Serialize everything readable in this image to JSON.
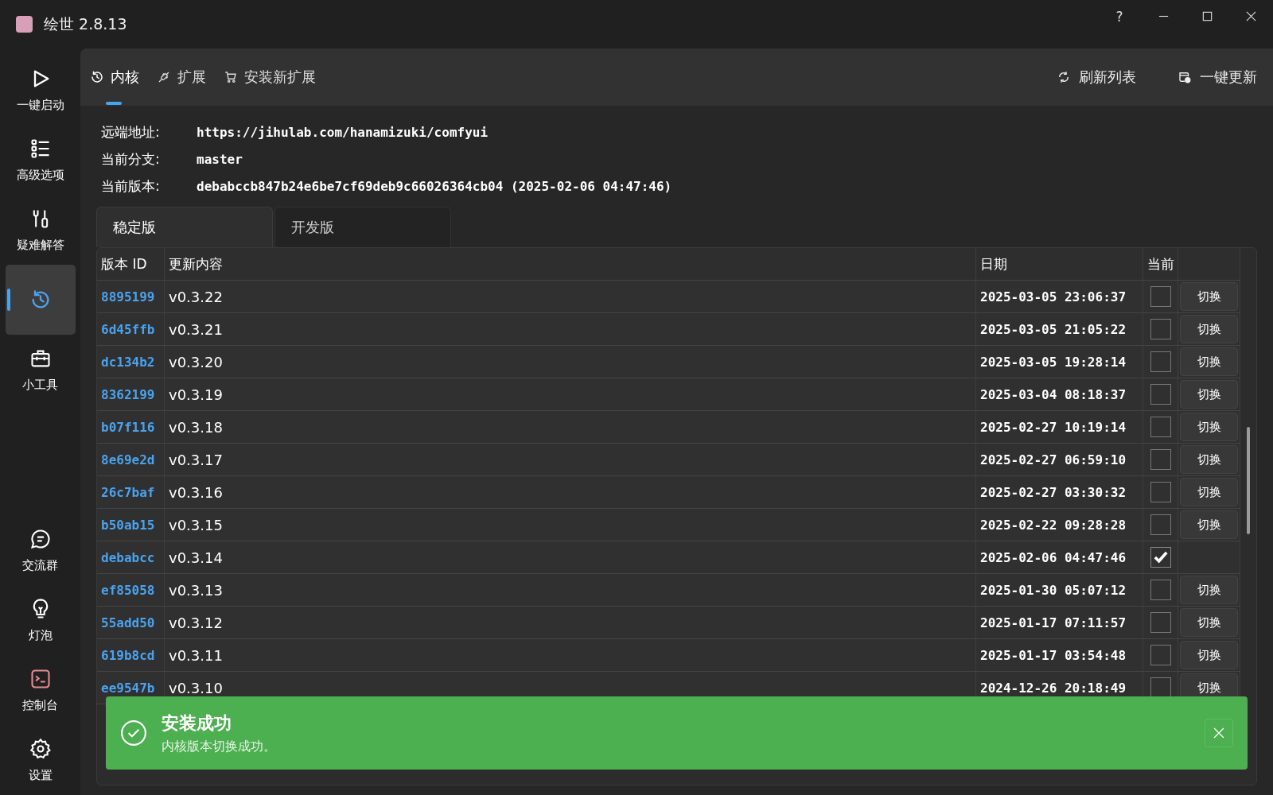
{
  "window": {
    "title": "绘世 2.8.13",
    "help": "?"
  },
  "sidebar": {
    "items": [
      {
        "kind": "play",
        "label": "一键启动",
        "selected": false
      },
      {
        "kind": "list",
        "label": "高级选项",
        "selected": false
      },
      {
        "kind": "tools",
        "label": "疑难解答",
        "selected": false
      },
      {
        "kind": "history",
        "selected": true
      },
      {
        "kind": "toolbox",
        "label": "小工具",
        "selected": false
      },
      {
        "kind": "spacer"
      },
      {
        "kind": "chat",
        "label": "交流群",
        "selected": false
      },
      {
        "kind": "bulb",
        "label": "灯泡",
        "selected": false
      },
      {
        "kind": "console",
        "label": "控制台",
        "selected": false
      },
      {
        "kind": "gear",
        "label": "设置",
        "selected": false
      }
    ]
  },
  "tabs": [
    {
      "kind": "history",
      "label": "内核",
      "selected": true
    },
    {
      "kind": "plug",
      "label": "扩展",
      "selected": false
    },
    {
      "kind": "cart",
      "label": "安装新扩展",
      "selected": false
    }
  ],
  "actions": [
    {
      "kind": "refresh",
      "label": "刷新列表"
    },
    {
      "kind": "update",
      "label": "一键更新"
    }
  ],
  "info": [
    {
      "label": "远端地址:",
      "value": "https://jihulab.com/hanamizuki/comfyui"
    },
    {
      "label": "当前分支:",
      "value": "master"
    },
    {
      "label": "当前版本:",
      "value": "debabccb847b24e6be7cf69deb9c66026364cb04 (2025-02-06 04:47:46)"
    }
  ],
  "channel_tabs": [
    {
      "label": "稳定版",
      "selected": true
    },
    {
      "label": "开发版",
      "selected": false
    }
  ],
  "table": {
    "columns": [
      "版本 ID",
      "更新内容",
      "日期",
      "当前"
    ],
    "rows": [
      {
        "id": "8895199",
        "content": "v0.3.22",
        "date": "2025-03-05 23:06:37",
        "current": false,
        "action": "切换"
      },
      {
        "id": "6d45ffb",
        "content": "v0.3.21",
        "date": "2025-03-05 21:05:22",
        "current": false,
        "action": "切换"
      },
      {
        "id": "dc134b2",
        "content": "v0.3.20",
        "date": "2025-03-05 19:28:14",
        "current": false,
        "action": "切换"
      },
      {
        "id": "8362199",
        "content": "v0.3.19",
        "date": "2025-03-04 08:18:37",
        "current": false,
        "action": "切换"
      },
      {
        "id": "b07f116",
        "content": "v0.3.18",
        "date": "2025-02-27 10:19:14",
        "current": false,
        "action": "切换"
      },
      {
        "id": "8e69e2d",
        "content": "v0.3.17",
        "date": "2025-02-27 06:59:10",
        "current": false,
        "action": "切换"
      },
      {
        "id": "26c7baf",
        "content": "v0.3.16",
        "date": "2025-02-27 03:30:32",
        "current": false,
        "action": "切换"
      },
      {
        "id": "b50ab15",
        "content": "v0.3.15",
        "date": "2025-02-22 09:28:28",
        "current": false,
        "action": "切换"
      },
      {
        "id": "debabcc",
        "content": "v0.3.14",
        "date": "2025-02-06 04:47:46",
        "current": true
      },
      {
        "id": "ef85058",
        "content": "v0.3.13",
        "date": "2025-01-30 05:07:12",
        "current": false,
        "action": "切换"
      },
      {
        "id": "55add50",
        "content": "v0.3.12",
        "date": "2025-01-17 07:11:57",
        "current": false,
        "action": "切换"
      },
      {
        "id": "619b8cd",
        "content": "v0.3.11",
        "date": "2025-01-17 03:54:48",
        "current": false,
        "action": "切换"
      },
      {
        "id": "ee9547b",
        "content": "v0.3.10",
        "date": "2024-12-26 20:18:49",
        "current": false,
        "action": "切换"
      }
    ]
  },
  "toast": {
    "title": "安装成功",
    "message": "内核版本切换成功。"
  }
}
